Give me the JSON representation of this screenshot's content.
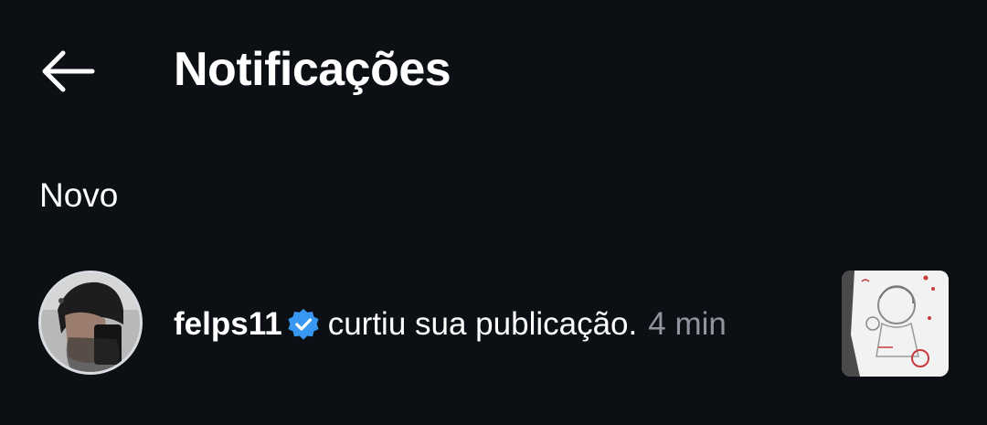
{
  "header": {
    "title": "Notificações",
    "back_icon": "arrow-left-icon"
  },
  "section": {
    "title": "Novo"
  },
  "notifications": [
    {
      "username": "felps11",
      "verified": true,
      "action": "curtiu sua publicação.",
      "time": "4 min",
      "avatar_icon": "user-avatar-photo",
      "thumbnail_icon": "post-thumbnail-sketch"
    }
  ],
  "colors": {
    "background": "#0c0f14",
    "text_primary": "#ffffff",
    "text_secondary": "#8e959e",
    "verified_blue": "#3897f0"
  }
}
